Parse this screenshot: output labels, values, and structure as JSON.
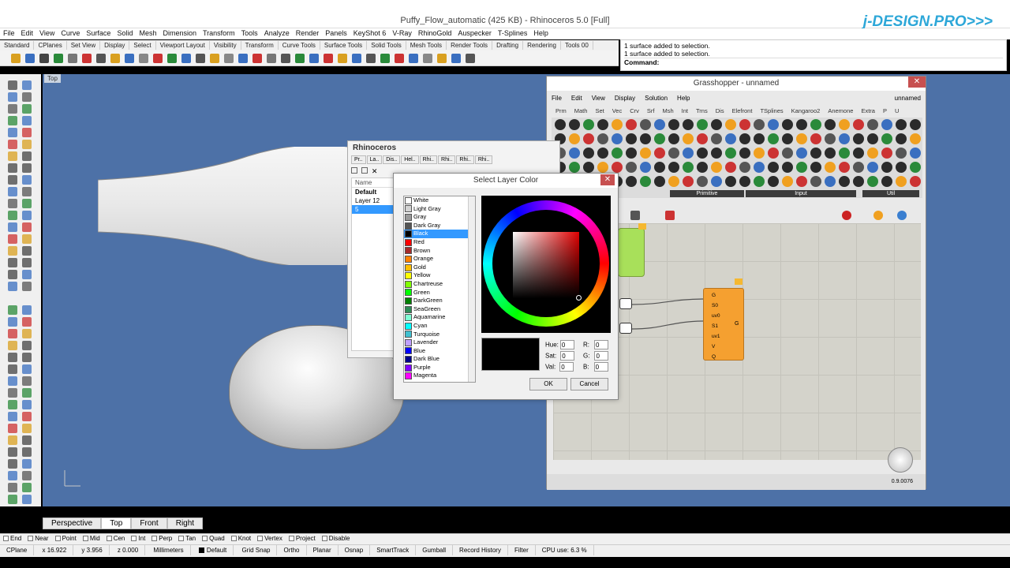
{
  "window": {
    "title": "Puffy_Flow_automatic (425 KB) - Rhinoceros 5.0 [Full]",
    "brand": "j-DESIGN.PRO>>>"
  },
  "menus": [
    "File",
    "Edit",
    "View",
    "Curve",
    "Surface",
    "Solid",
    "Mesh",
    "Dimension",
    "Transform",
    "Tools",
    "Analyze",
    "Render",
    "Panels",
    "KeyShot 6",
    "V-Ray",
    "RhinoGold",
    "Auspecker",
    "T-Splines",
    "Help"
  ],
  "toolbar_tabs": [
    "Standard",
    "CPlanes",
    "Set View",
    "Display",
    "Select",
    "Viewport Layout",
    "Visibility",
    "Transform",
    "Curve Tools",
    "Surface Tools",
    "Solid Tools",
    "Mesh Tools",
    "Render Tools",
    "Drafting",
    "Rendering",
    "Tools 00",
    "New in V"
  ],
  "command": {
    "history": [
      "1 surface added to selection.",
      "1 surface added to selection."
    ],
    "prompt": "Command:"
  },
  "viewport": {
    "label": "Top"
  },
  "view_tabs": [
    "Perspective",
    "Top",
    "Front",
    "Right"
  ],
  "snaps": [
    "End",
    "Near",
    "Point",
    "Mid",
    "Cen",
    "Int",
    "Perp",
    "Tan",
    "Quad",
    "Knot",
    "Vertex",
    "Project",
    "Disable"
  ],
  "status": {
    "cplane": "CPlane",
    "x": "x 16.922",
    "y": "y 3.956",
    "z": "z 0.000",
    "units": "Millimeters",
    "layer": "Default",
    "items": [
      "Grid Snap",
      "Ortho",
      "Planar",
      "Osnap",
      "SmartTrack",
      "Gumball",
      "Record History",
      "Filter",
      "CPU use: 6.3 %"
    ]
  },
  "grasshopper": {
    "title": "Grasshopper - unnamed",
    "menus": [
      "File",
      "Edit",
      "View",
      "Display",
      "Solution",
      "Help"
    ],
    "doc": "unnamed",
    "tabs": [
      "Prm",
      "Math",
      "Set",
      "Vec",
      "Crv",
      "Srf",
      "Msh",
      "Int",
      "Trns",
      "Dis",
      "Elefront",
      "TSplines",
      "Kangaroo2",
      "Anemone",
      "Extra",
      "P",
      "U"
    ],
    "groups": [
      "Primitive",
      "Input",
      "Util"
    ],
    "component": {
      "inputs": [
        "G",
        "S0",
        "uv0",
        "S1",
        "uv1",
        "V",
        "Q"
      ],
      "output": "G"
    },
    "version": "0.9.0076"
  },
  "layers_panel": {
    "title": "Rhinoceros",
    "tabs": [
      "Pr..",
      "La..",
      "Dis..",
      "Hel..",
      "Rhi..",
      "Rhi..",
      "Rhi..",
      "Rhi.."
    ],
    "column": "Name",
    "layers": [
      "Default",
      "Layer 12",
      "5"
    ]
  },
  "color_dialog": {
    "title": "Select Layer Color",
    "colors": [
      {
        "name": "White",
        "hex": "#ffffff"
      },
      {
        "name": "Light Gray",
        "hex": "#d3d3d3"
      },
      {
        "name": "Gray",
        "hex": "#9a9a9a"
      },
      {
        "name": "Dark Gray",
        "hex": "#555555"
      },
      {
        "name": "Black",
        "hex": "#000000"
      },
      {
        "name": "Red",
        "hex": "#ff0000"
      },
      {
        "name": "Brown",
        "hex": "#a52a2a"
      },
      {
        "name": "Orange",
        "hex": "#ff8000"
      },
      {
        "name": "Gold",
        "hex": "#ffc000"
      },
      {
        "name": "Yellow",
        "hex": "#ffff00"
      },
      {
        "name": "Chartreuse",
        "hex": "#80ff00"
      },
      {
        "name": "Green",
        "hex": "#00ff00"
      },
      {
        "name": "DarkGreen",
        "hex": "#008000"
      },
      {
        "name": "SeaGreen",
        "hex": "#2e8b57"
      },
      {
        "name": "Aquamarine",
        "hex": "#7fffd4"
      },
      {
        "name": "Cyan",
        "hex": "#00ffff"
      },
      {
        "name": "Turquoise",
        "hex": "#40c0d0"
      },
      {
        "name": "Lavender",
        "hex": "#c0a0ff"
      },
      {
        "name": "Blue",
        "hex": "#0000ff"
      },
      {
        "name": "Dark Blue",
        "hex": "#00008b"
      },
      {
        "name": "Purple",
        "hex": "#8000ff"
      },
      {
        "name": "Magenta",
        "hex": "#ff00ff"
      }
    ],
    "selected": "Black",
    "hue": "0",
    "sat": "0",
    "val": "0",
    "r": "0",
    "g": "0",
    "b": "0",
    "labels": {
      "hue": "Hue:",
      "sat": "Sat:",
      "val": "Val:",
      "r": "R:",
      "g": "G:",
      "b": "B:"
    },
    "ok": "OK",
    "cancel": "Cancel"
  }
}
